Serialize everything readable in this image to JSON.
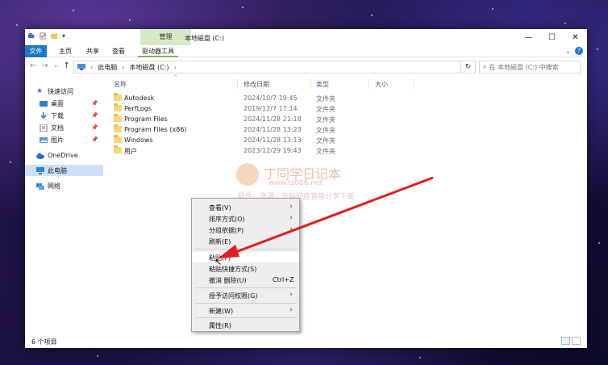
{
  "window": {
    "title": "本地磁盘 (C:)",
    "manage_tab": "管理",
    "controls": {
      "minimize": "—",
      "maximize": "☐",
      "close": "✕"
    }
  },
  "ribbon": {
    "tabs": [
      "文件",
      "主页",
      "共享",
      "查看",
      "驱动器工具"
    ],
    "help": "?"
  },
  "address": {
    "crumbs": [
      "此电脑",
      "本地磁盘 (C:)"
    ],
    "search_placeholder": "在 本地磁盘 (C:) 中搜索"
  },
  "sidebar": {
    "items": [
      {
        "label": "快速访问",
        "icon": "star-icon"
      },
      {
        "label": "桌面",
        "icon": "desktop-icon",
        "pinned": true
      },
      {
        "label": "下载",
        "icon": "download-icon",
        "pinned": true
      },
      {
        "label": "文档",
        "icon": "document-icon",
        "pinned": true
      },
      {
        "label": "图片",
        "icon": "picture-icon",
        "pinned": true
      },
      {
        "label": "OneDrive",
        "icon": "cloud-icon"
      },
      {
        "label": "此电脑",
        "icon": "computer-icon",
        "selected": true
      },
      {
        "label": "网络",
        "icon": "network-icon"
      }
    ]
  },
  "columns": [
    "名称",
    "修改日期",
    "类型",
    "大小"
  ],
  "files": [
    {
      "name": "Autodesk",
      "date": "2024/10/7 19:45",
      "type": "文件夹"
    },
    {
      "name": "PerfLogs",
      "date": "2019/12/7 17:14",
      "type": "文件夹"
    },
    {
      "name": "Program Files",
      "date": "2024/11/28 21:18",
      "type": "文件夹"
    },
    {
      "name": "Program Files (x86)",
      "date": "2024/11/28 13:23",
      "type": "文件夹"
    },
    {
      "name": "Windows",
      "date": "2024/11/28 13:13",
      "type": "文件夹"
    },
    {
      "name": "用户",
      "date": "2023/12/29 19:43",
      "type": "文件夹"
    }
  ],
  "status": {
    "count": "6 个项目"
  },
  "context_menu": {
    "items": [
      {
        "label": "查看(V)",
        "submenu": true
      },
      {
        "label": "排序方式(O)",
        "submenu": true
      },
      {
        "label": "分组依据(P)",
        "submenu": true
      },
      {
        "label": "刷新(E)"
      },
      {
        "label": "粘贴(P)",
        "hover": true
      },
      {
        "label": "粘贴快捷方式(S)"
      },
      {
        "label": "撤消 删除(U)",
        "shortcut": "Ctrl+Z"
      },
      {
        "label": "授予访问权限(G)",
        "submenu": true
      },
      {
        "label": "新建(W)",
        "submenu": true
      },
      {
        "label": "属性(R)"
      }
    ]
  },
  "watermark": {
    "title": "丁同学日记本",
    "url": "www.ts006.net",
    "sub": "软件、资源、资料网盘直接分享下载"
  },
  "colors": {
    "accent": "#1979ca",
    "arrow": "#e11d1d",
    "manage_tab": "#d4e9c4"
  }
}
